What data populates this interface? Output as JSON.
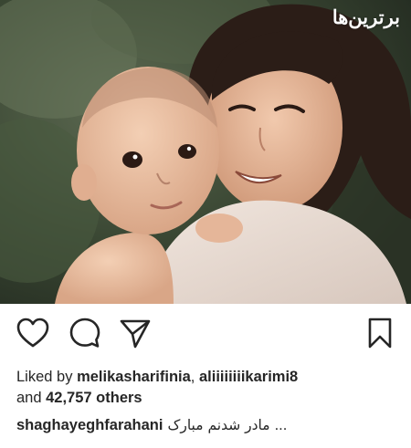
{
  "post": {
    "watermark": "برترین‌ها",
    "photo_description_icon": "photo-icon",
    "actions": {
      "like_icon": "heart-icon",
      "comment_icon": "comment-icon",
      "share_icon": "paper-plane-icon",
      "save_icon": "bookmark-icon"
    },
    "likes": {
      "prefix": "Liked by",
      "user1": "melikasharifinia",
      "separator": ",",
      "user2": "aliiiiiiiikarimi8",
      "and": "and",
      "count": "42,757 others"
    },
    "caption": {
      "username": "shaghayeghfarahani",
      "text": "مادر شدنم مبارک",
      "more": "..."
    },
    "colors": {
      "text": "#262626",
      "background": "#ffffff"
    }
  }
}
